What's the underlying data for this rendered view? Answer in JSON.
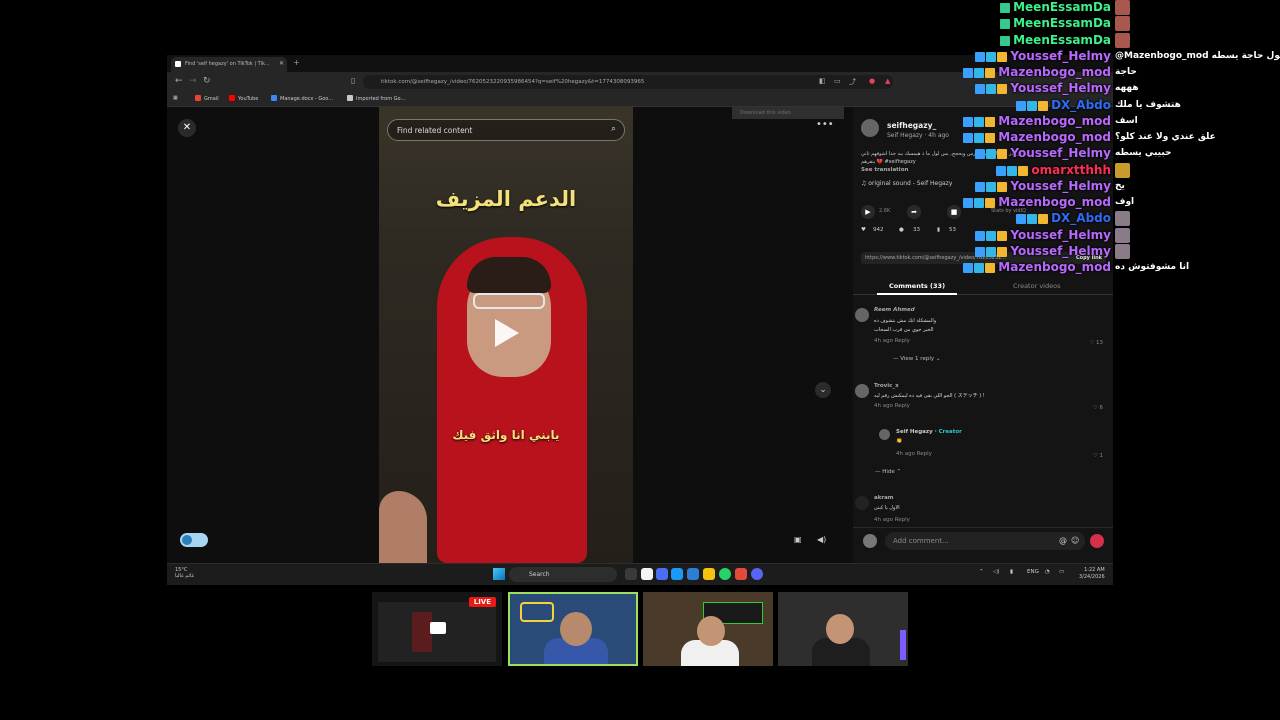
{
  "browser": {
    "tab_title": "Find 'seif hegazy' on TikTok | Tik...",
    "url": "tiktok.com/@seifhegazy_/video/7620523220935986454?q=seif%20hegazy&t=1774308093965",
    "bookmarks": [
      "Gmail",
      "YouTube",
      "Manage.docx - Goo...",
      "Imported from Go..."
    ]
  },
  "video": {
    "search_placeholder": "Find related content",
    "title_text": "الدعم المزيف",
    "subtitle_text": "يابني انا واثق فيك",
    "download_banner": "Download this video"
  },
  "panel": {
    "author": "seifhegazy_",
    "author_sub": "Seif Hegazy · 4h ago",
    "description": "لو فريندز ويتسابوا في الدرس ويحجج, بس لول ما د هيمسك بيه جدا اشوفهم ثاني",
    "description_2": "ينقرهم 💔 #seifhegazy",
    "see_translation": "See translation",
    "sound": "♫ original sound - Seif Hegazy",
    "stats_link": "Stats by vidIQ",
    "likes": "942",
    "comments_count": "33",
    "saves": "53",
    "link": "https://www.tiktok.com/@seifhegazy_/video/76205232...",
    "copy_link": "Copy link",
    "tab_comments": "Comments (33)",
    "tab_creator": "Creator videos",
    "comments": [
      {
        "name": "Reem Ahmed",
        "text1": "والمشكلة انك مش بتشوف ده",
        "text2": "الخير جوي من قرب السحاب",
        "meta": "4h ago   Reply",
        "likes": "13",
        "replies": "View 1 reply"
      },
      {
        "name": "Trovic_x",
        "text1": "الجو اللي بقى فيه ده ليمكنش رقم ليه ( ステッチ ) !",
        "meta": "4h ago   Reply",
        "likes": "6"
      },
      {
        "name": "Seif Hegazy",
        "creator": "Creator",
        "text1": "👏",
        "meta": "4h ago   Reply",
        "likes": "1",
        "hide": "Hide"
      },
      {
        "name": "akram",
        "text1": "الاول يا كبتن",
        "meta": "4h ago   Reply"
      }
    ],
    "add_comment_placeholder": "Add comment..."
  },
  "taskbar": {
    "weather_temp": "15°C",
    "weather_desc": "غائم غالبا",
    "search": "Search",
    "lang": "ENG",
    "time": "1:22 AM",
    "date": "3/24/2026"
  },
  "chat": [
    {
      "user": "MeenEssamDa",
      "color": "#3df08b",
      "msg": "",
      "emote": "#a8574d"
    },
    {
      "user": "MeenEssamDa",
      "color": "#3df08b",
      "msg": "",
      "emote": "#a8574d"
    },
    {
      "user": "MeenEssamDa",
      "color": "#3df08b",
      "msg": "",
      "emote": "#a8574d"
    },
    {
      "user": "Youssef_Helmy",
      "color": "#b968ff",
      "msg": "@Mazenbogo_mod ما تقول حاجة يسطه"
    },
    {
      "user": "Mazenbogo_mod",
      "color": "#b968ff",
      "msg": "حاجة"
    },
    {
      "user": "Youssef_Helmy",
      "color": "#b968ff",
      "msg": "هههه"
    },
    {
      "user": "DX_Abdo",
      "color": "#2e6cf6",
      "msg": "هتشوف يا ملك"
    },
    {
      "user": "Mazenbogo_mod",
      "color": "#b968ff",
      "msg": "اسف"
    },
    {
      "user": "Mazenbogo_mod",
      "color": "#b968ff",
      "msg": "علق عندي ولا عند كلو؟"
    },
    {
      "user": "Youssef_Helmy",
      "color": "#b968ff",
      "msg": "حبيبي يسطه"
    },
    {
      "user": "omarxtthhh",
      "color": "#ff2d55",
      "msg": "",
      "emote": "#c99b2a"
    },
    {
      "user": "Youssef_Helmy",
      "color": "#b968ff",
      "msg": "يخ"
    },
    {
      "user": "Mazenbogo_mod",
      "color": "#b968ff",
      "msg": "اوف"
    },
    {
      "user": "DX_Abdo",
      "color": "#2e6cf6",
      "msg": "",
      "emote": "#8a7b89"
    },
    {
      "user": "Youssef_Helmy",
      "color": "#b968ff",
      "msg": "",
      "emote": "#8a7b89"
    },
    {
      "user": "Youssef_Helmy",
      "color": "#b968ff",
      "msg": "",
      "emote": "#8a7b89"
    },
    {
      "user": "Mazenbogo_mod",
      "color": "#b968ff",
      "msg": "انا مشوفتوش ده"
    }
  ],
  "thumbs": {
    "live_label": "LIVE"
  }
}
